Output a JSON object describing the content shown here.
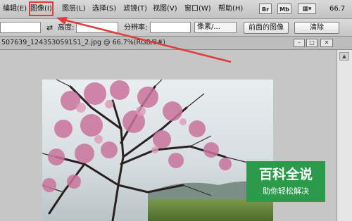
{
  "menubar": {
    "items": [
      "编辑(E)",
      "图像(I)",
      "图层(L)",
      "选择(S)",
      "滤镜(T)",
      "视图(V)",
      "窗口(W)",
      "帮助(H)"
    ],
    "chips": [
      "Br",
      "Mb"
    ],
    "zoom": "66.7"
  },
  "options": {
    "height_label": "高度:",
    "resolution_label": "分辨率:",
    "unit_select": "像素/...",
    "front_image_button": "前面的图像",
    "clear_button": "清除"
  },
  "document": {
    "title": "507639_124353059151_2.jpg @ 66.7%(RGB/8#)"
  },
  "watermark": {
    "title": "百科全说",
    "subtitle": "助你轻松解决"
  },
  "colors": {
    "highlight": "#e23b3b",
    "watermark_bg": "#2b9a4a"
  }
}
